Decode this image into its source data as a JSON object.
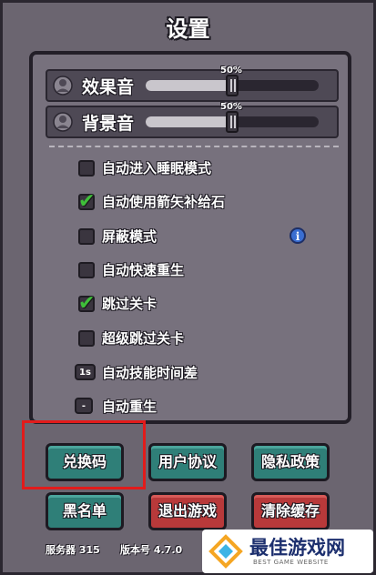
{
  "title": "设置",
  "volumes": [
    {
      "label": "效果音",
      "percent_text": "50%",
      "value": 0.5
    },
    {
      "label": "背景音",
      "percent_text": "50%",
      "value": 0.5
    }
  ],
  "options": [
    {
      "label": "自动进入睡眠模式",
      "checked": false,
      "kind": "checkbox"
    },
    {
      "label": "自动使用箭矢补给石",
      "checked": true,
      "kind": "checkbox"
    },
    {
      "label": "屏蔽模式",
      "checked": false,
      "kind": "checkbox"
    },
    {
      "label": "自动快速重生",
      "checked": false,
      "kind": "checkbox"
    },
    {
      "label": "跳过关卡",
      "checked": true,
      "kind": "checkbox"
    },
    {
      "label": "超级跳过关卡",
      "checked": false,
      "kind": "checkbox"
    },
    {
      "label": "自动技能时间差",
      "tag": "1s",
      "kind": "tag"
    },
    {
      "label": "自动重生",
      "tag": "-",
      "kind": "tag"
    }
  ],
  "info_glyph": "i",
  "buttons": {
    "redeem": "兑换码",
    "agreement": "用户协议",
    "privacy": "隐私政策",
    "blacklist": "黑名单",
    "exit": "退出游戏",
    "clear_cache": "清除缓存"
  },
  "footer": {
    "server": "服务器 315",
    "version": "版本号 4.7.0"
  },
  "watermark": {
    "title": "最佳游戏网",
    "subtitle": "BEST GAME WEBSITE"
  },
  "colors": {
    "teal_button": "#2f7f78",
    "red_button": "#b8393a",
    "highlight": "#e21b1b",
    "check": "#3fbf3a"
  }
}
